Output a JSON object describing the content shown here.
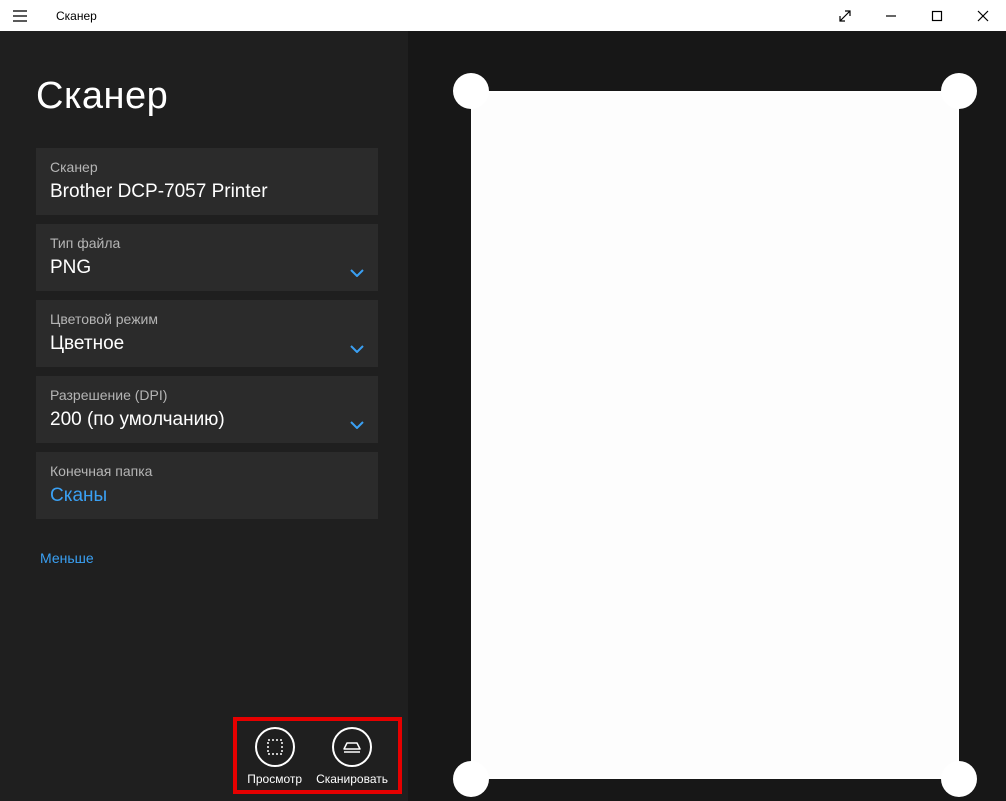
{
  "window": {
    "title": "Сканер"
  },
  "page": {
    "heading": "Сканер"
  },
  "fields": {
    "scanner": {
      "label": "Сканер",
      "value": "Brother DCP-7057 Printer"
    },
    "filetype": {
      "label": "Тип файла",
      "value": "PNG"
    },
    "colormode": {
      "label": "Цветовой режим",
      "value": "Цветное"
    },
    "dpi": {
      "label": "Разрешение (DPI)",
      "value": "200 (по умолчанию)"
    },
    "destfolder": {
      "label": "Конечная папка",
      "value": "Сканы"
    }
  },
  "links": {
    "less": "Меньше"
  },
  "actions": {
    "preview": "Просмотр",
    "scan": "Сканировать"
  }
}
